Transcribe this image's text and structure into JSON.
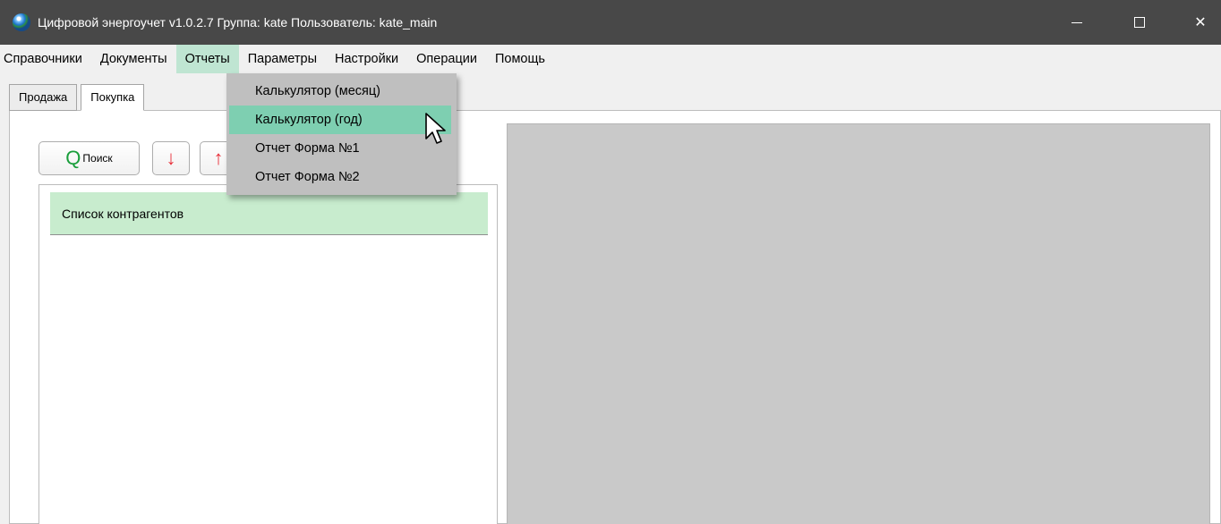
{
  "window": {
    "title": "Цифровой энергоучет v1.0.2.7 Группа: kate Пользователь: kate_main",
    "icon": "globe-icon",
    "close_glyph": "✕"
  },
  "menu": {
    "items": [
      "Справочники",
      "Документы",
      "Отчеты",
      "Параметры",
      "Настройки",
      "Операции",
      "Помощь"
    ],
    "active_index": 2,
    "active_color": "#bfe5d2"
  },
  "reports_menu": {
    "items": [
      "Калькулятор (месяц)",
      "Калькулятор (год)",
      "Отчет Форма №1",
      "Отчет Форма №2"
    ],
    "hovered_index": 1,
    "hover_color": "#7ecfb1"
  },
  "tabs": {
    "items": [
      "Продажа",
      "Покупка"
    ],
    "selected_index": 1
  },
  "toolbar": {
    "search_label": "Поиск",
    "search_icon": "search-icon",
    "search_icon_glyph": "Q",
    "down_icon_glyph": "↓",
    "up_icon_glyph": "↑",
    "accent_green": "#1a9e3b",
    "arrow_red": "#e8303a"
  },
  "contractors": {
    "header": "Список контрагентов",
    "header_color": "#c8ecce"
  }
}
